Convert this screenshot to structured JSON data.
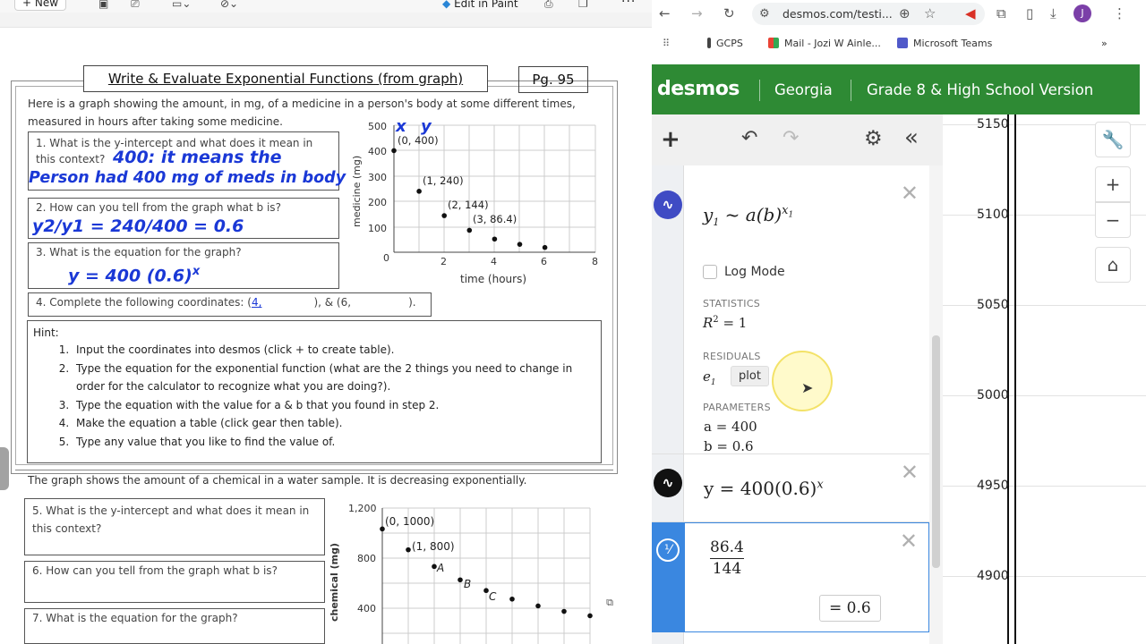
{
  "viewer": {
    "new_label": "New",
    "edit_in_paint": "Edit in Paint"
  },
  "worksheet": {
    "title": "Write & Evaluate Exponential Functions (from graph)",
    "page": "Pg. 95",
    "intro": "Here is a graph showing the amount, in mg, of a medicine in a person's body at some different times, measured in hours after taking some medicine.",
    "q1": "1. What is the y-intercept and what does it mean in this context?",
    "q1_answer_a": "400: it means the",
    "q1_answer_b": "Person had 400 mg of meds in body",
    "q2": "2. How can you tell from the graph what b is?",
    "q2_answer": "y2/y1 = 240/400 = 0.6",
    "q3": "3. What is the equation for the graph?",
    "q3_answer": "y = 400 (0.6)",
    "q3_answer_exp": "x",
    "q4_a": "4. Complete the following coordinates: (",
    "q4_b": "4,",
    "q4_c": "), & (6,",
    "q4_d": ").",
    "hint_title": "Hint:",
    "hints": [
      "Input the coordinates into desmos (click + to create table).",
      "Type the equation for the exponential function (what are the 2 things you need to change in order for the calculator to recognize what you are doing?).",
      "Type the equation with the value for a & b that you found in step 2.",
      "Make the equation a table (click gear then table).",
      "Type any value that you like to find the value of."
    ],
    "graph1": {
      "ylabel": "medicine (mg)",
      "xlabel": "time (hours)",
      "hw_x": "x",
      "hw_y": "y",
      "y_ticks": [
        "500",
        "400",
        "300",
        "200",
        "100"
      ],
      "x_ticks": [
        "0",
        "2",
        "4",
        "6",
        "8"
      ],
      "points": [
        [
          0,
          400
        ],
        [
          1,
          240
        ],
        [
          2,
          144
        ],
        [
          3,
          86.4
        ],
        [
          4,
          51.84
        ],
        [
          5,
          31.1
        ],
        [
          6,
          18.66
        ]
      ],
      "labels": [
        "(0, 400)",
        "(1, 240)",
        "(2, 144)",
        "(3, 86.4)"
      ]
    },
    "section2_intro": "The graph shows the amount of a chemical in a water sample. It is decreasing exponentially.",
    "q5": "5. What is the y-intercept and what does it mean in this context?",
    "q6": "6. How can you tell from the graph what b is?",
    "q7": "7. What is the equation for the graph?",
    "graph2": {
      "ylabel": "chemical (mg)",
      "y_ticks": [
        "1,200",
        "800",
        "400"
      ],
      "points": [
        [
          0,
          1000
        ],
        [
          1,
          800
        ],
        [
          2,
          640
        ],
        [
          3,
          512
        ],
        [
          4,
          409.6
        ],
        [
          5,
          327.7
        ],
        [
          6,
          262.1
        ],
        [
          7,
          209.7
        ],
        [
          8,
          167.8
        ]
      ],
      "labels": [
        "(0, 1000)",
        "(1, 800)",
        "A",
        "B",
        "C"
      ]
    }
  },
  "browser": {
    "url": "desmos.com/testi...",
    "profile_initial": "J",
    "bookmarks": [
      "GCPS",
      "Mail - Jozi W Ainle...",
      "Microsoft Teams"
    ]
  },
  "desmos": {
    "logo": "desmos",
    "state": "Georgia",
    "version": "Grade 8 & High School Version",
    "expr1": {
      "formula_y": "y",
      "formula_sub1": "1",
      "formula_mid": "~ a(b)",
      "formula_x": "x",
      "formula_sub2": "1",
      "log_mode": "Log Mode",
      "statistics_label": "STATISTICS",
      "r2_label": "R",
      "r2_exp": "2",
      "r2_value": "= 1",
      "residuals_label": "RESIDUALS",
      "residual_var": "e",
      "residual_sub": "1",
      "plot_btn": "plot",
      "parameters_label": "PARAMETERS",
      "param_a": "a = 400",
      "param_b": "b = 0.6"
    },
    "expr2": {
      "formula": "y = 400(0.6)",
      "exp": "x"
    },
    "expr3": {
      "numerator": "86.4",
      "denominator": "144",
      "result": "= 0.6"
    },
    "graph_y_labels": [
      "5150",
      "5100",
      "5050",
      "5000",
      "4950",
      "4900"
    ]
  }
}
